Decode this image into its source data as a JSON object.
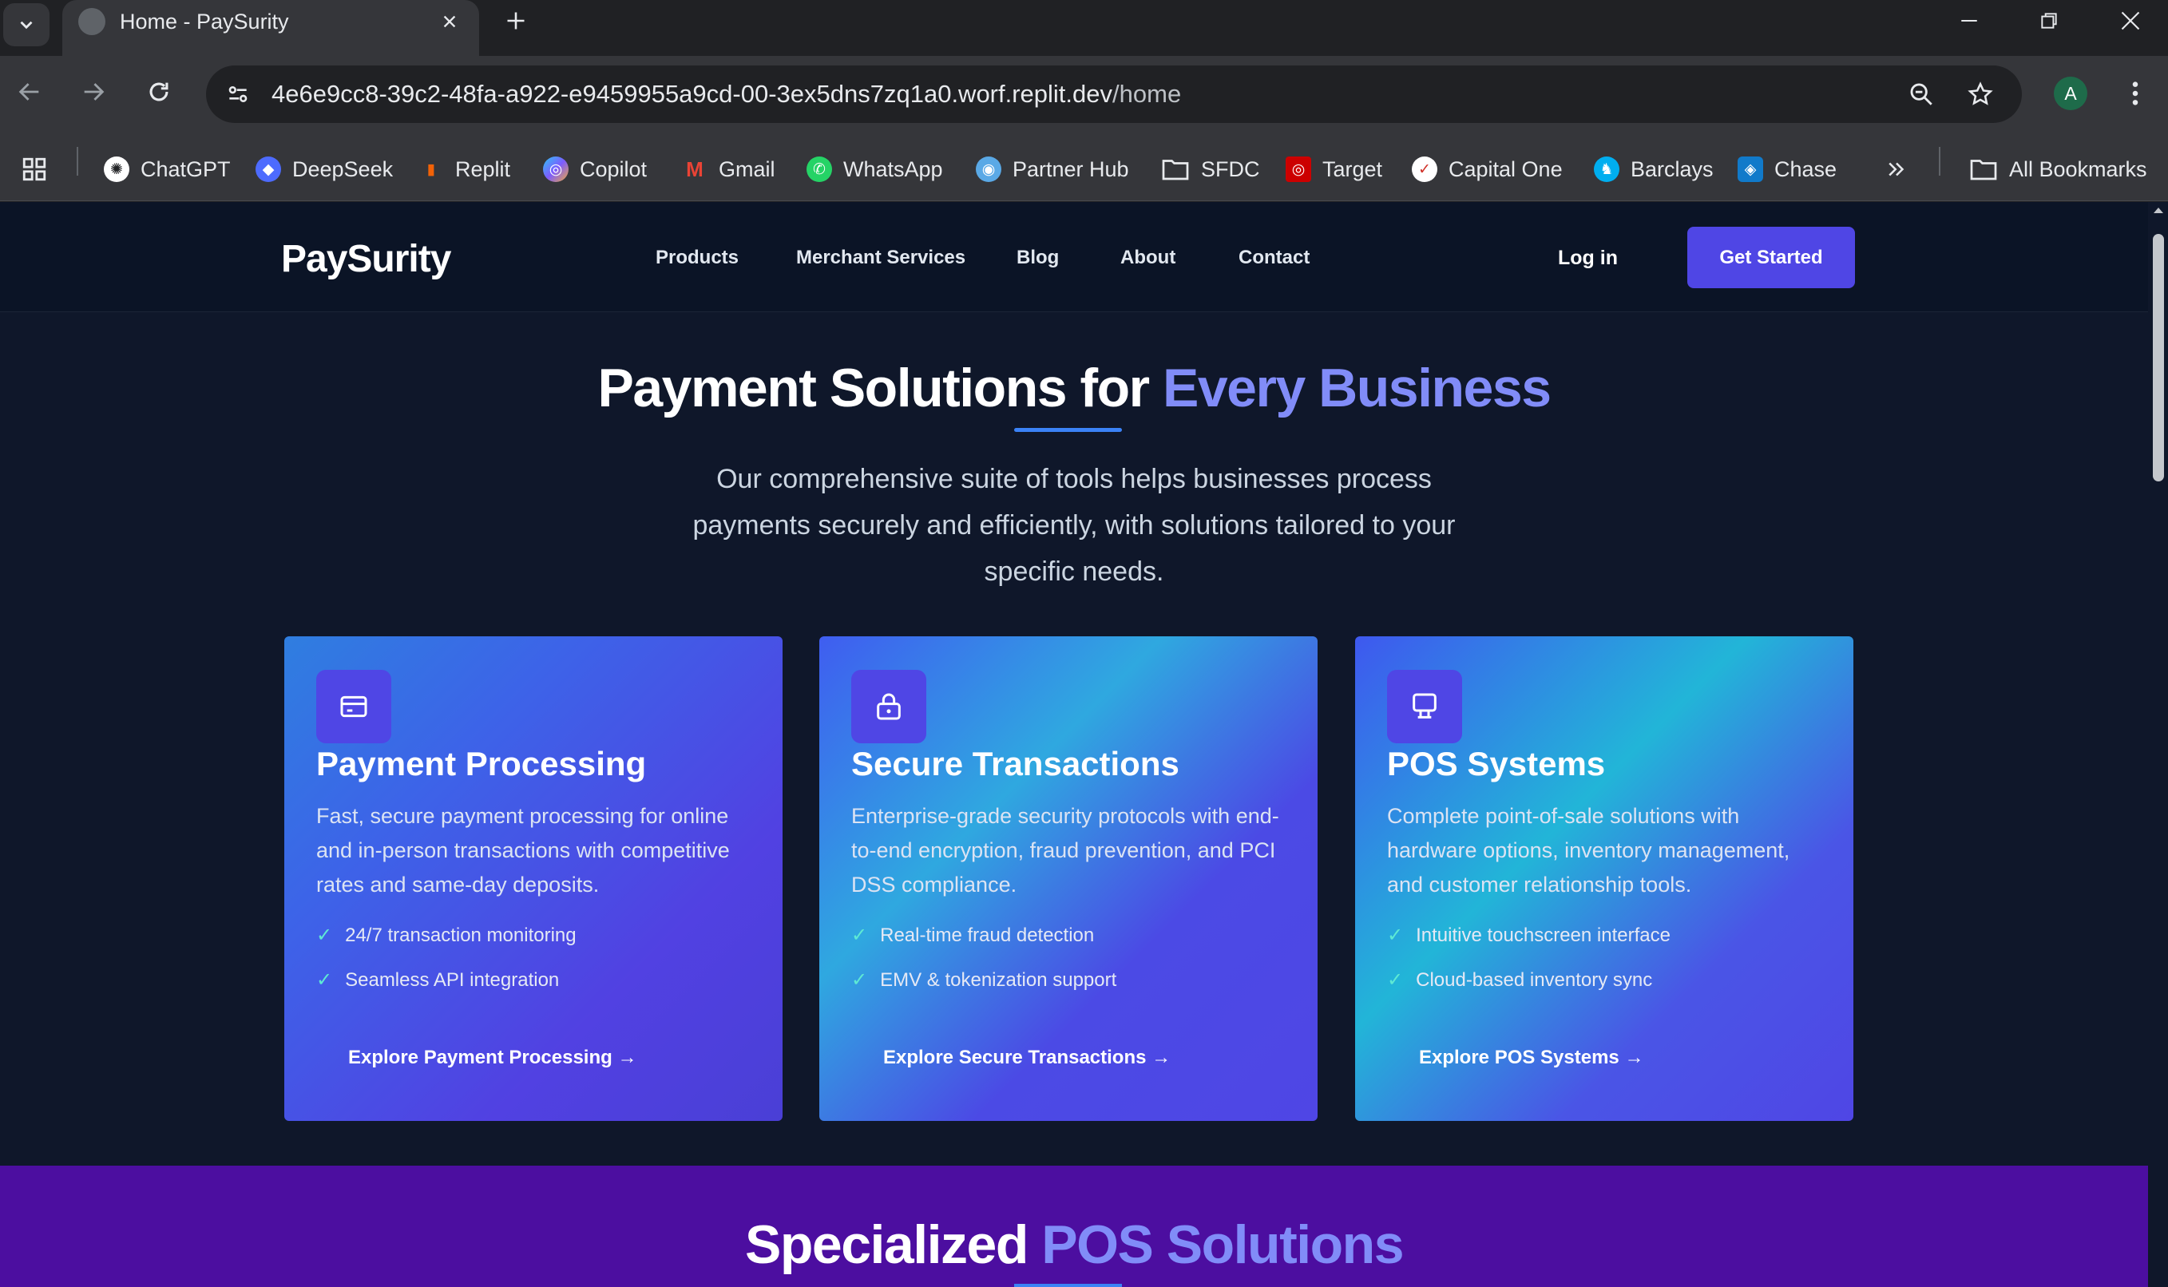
{
  "browser": {
    "tab_title": "Home - PaySurity",
    "url_host": "4e6e9cc8-39c2-48fa-a922-e9459955a9cd-00-3ex5dns7zq1a0.worf.replit.dev",
    "url_path": "/home",
    "profile_initial": "A",
    "bookmarks": [
      {
        "label": "ChatGPT",
        "icon": "chatgpt-icon",
        "color": "#ffffff"
      },
      {
        "label": "DeepSeek",
        "icon": "deepseek-icon",
        "color": "#4d6bfe"
      },
      {
        "label": "Replit",
        "icon": "replit-icon",
        "color": "#f26207"
      },
      {
        "label": "Copilot",
        "icon": "copilot-icon",
        "color": "#7c5cff"
      },
      {
        "label": "Gmail",
        "icon": "gmail-icon",
        "color": "#ea4335"
      },
      {
        "label": "WhatsApp",
        "icon": "whatsapp-icon",
        "color": "#25d366"
      },
      {
        "label": "Partner Hub",
        "icon": "partner-hub-icon",
        "color": "#5aa9e6"
      },
      {
        "label": "SFDC",
        "icon": "folder-icon",
        "color": "#e8eaed"
      },
      {
        "label": "Target",
        "icon": "target-icon",
        "color": "#cc0000"
      },
      {
        "label": "Capital One",
        "icon": "capital-one-icon",
        "color": "#d03027"
      },
      {
        "label": "Barclays",
        "icon": "barclays-icon",
        "color": "#00aeef"
      },
      {
        "label": "Chase",
        "icon": "chase-icon",
        "color": "#117aca"
      }
    ],
    "all_bookmarks": "All Bookmarks"
  },
  "site": {
    "logo": "PaySurity",
    "nav": [
      "Products",
      "Merchant Services",
      "Blog",
      "About",
      "Contact"
    ],
    "login": "Log in",
    "cta": "Get Started",
    "accent_color": "#4f46e5"
  },
  "hero": {
    "title_main": "Payment Solutions for ",
    "title_accent": "Every Business",
    "subtitle": "Our comprehensive suite of tools helps businesses process payments securely and efficiently, with solutions tailored to your specific needs."
  },
  "cards": [
    {
      "icon": "credit-card-icon",
      "title": "Payment Processing",
      "description": "Fast, secure payment processing for online and in-person transactions with competitive rates and same-day deposits.",
      "features": [
        "24/7 transaction monitoring",
        "Seamless API integration"
      ],
      "link": "Explore Payment Processing →"
    },
    {
      "icon": "lock-icon",
      "title": "Secure Transactions",
      "description": "Enterprise-grade security protocols with end-to-end encryption, fraud prevention, and PCI DSS compliance.",
      "features": [
        "Real-time fraud detection",
        "EMV & tokenization support"
      ],
      "link": "Explore Secure Transactions →"
    },
    {
      "icon": "pos-terminal-icon",
      "title": "POS Systems",
      "description": "Complete point-of-sale solutions with hardware options, inventory management, and customer relationship tools.",
      "features": [
        "Intuitive touchscreen interface",
        "Cloud-based inventory sync"
      ],
      "link": "Explore POS Systems →"
    }
  ],
  "pos_section": {
    "title_main": "Specialized ",
    "title_accent": "POS Solutions"
  }
}
